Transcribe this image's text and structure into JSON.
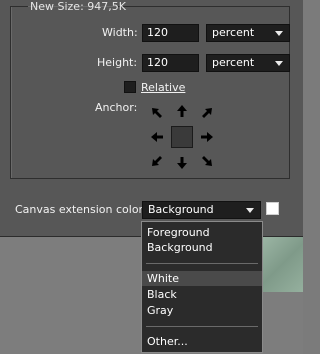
{
  "dialog": {
    "new_size_legend": "New Size: 947,5K",
    "width_label": "Width:",
    "width_value": "120",
    "width_unit": "percent",
    "height_label": "Height:",
    "height_value": "120",
    "height_unit": "percent",
    "relative_label": "Relative",
    "anchor_label": "Anchor:",
    "canvas_ext_label": "Canvas extension color:",
    "canvas_ext_value": "Background",
    "swatch_color": "#ffffff"
  },
  "menu": {
    "items": [
      "Foreground",
      "Background",
      "White",
      "Black",
      "Gray",
      "Other..."
    ],
    "selected": "White"
  }
}
